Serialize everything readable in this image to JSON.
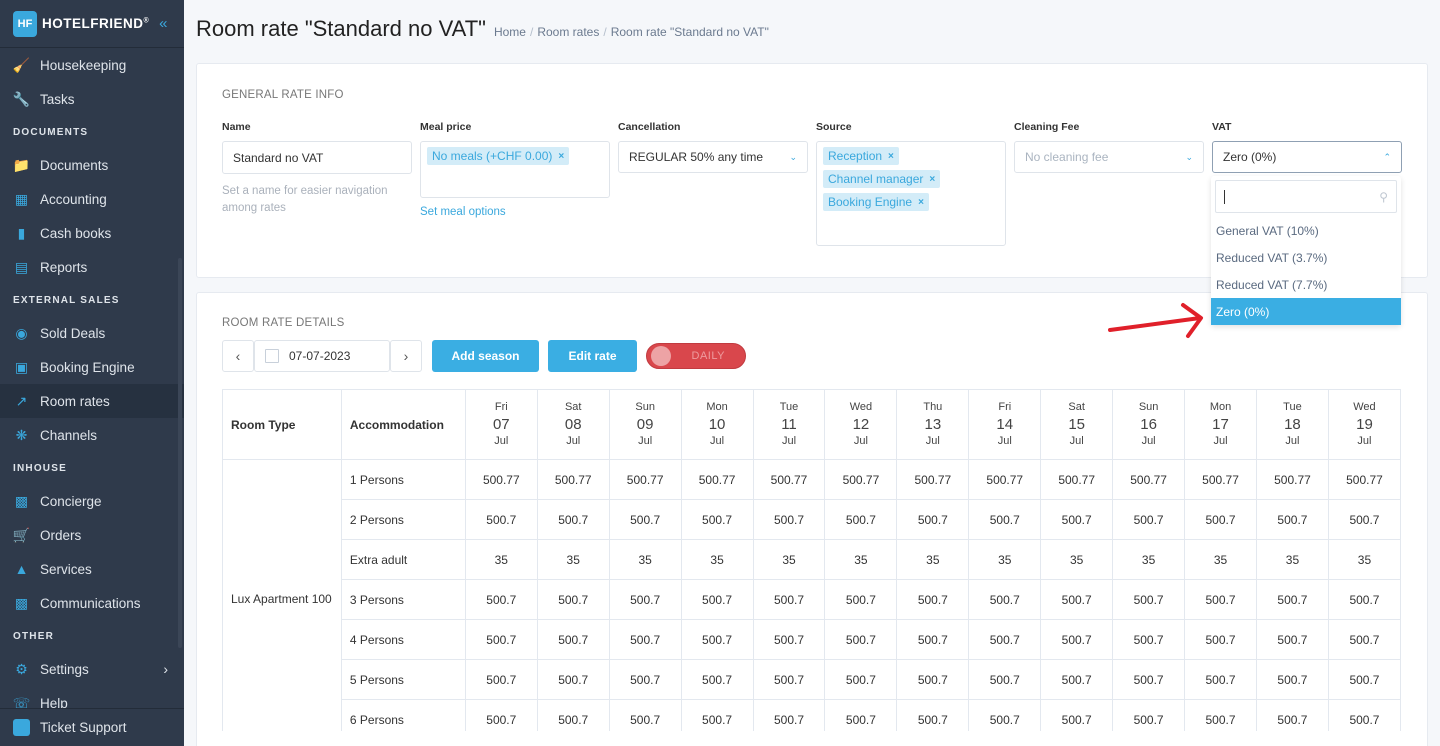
{
  "brand": {
    "name": "HOTELFRIEND",
    "reg": "®",
    "mark": "HF"
  },
  "sidebar": {
    "items": [
      {
        "type": "item",
        "label": "Housekeeping",
        "icon": "broom-icon"
      },
      {
        "type": "item",
        "label": "Tasks",
        "icon": "wrench-icon"
      },
      {
        "type": "section",
        "label": "DOCUMENTS"
      },
      {
        "type": "item",
        "label": "Documents",
        "icon": "folder-icon"
      },
      {
        "type": "item",
        "label": "Accounting",
        "icon": "calculator-icon"
      },
      {
        "type": "item",
        "label": "Cash books",
        "icon": "cash-book-icon"
      },
      {
        "type": "item",
        "label": "Reports",
        "icon": "clipboard-icon"
      },
      {
        "type": "section",
        "label": "EXTERNAL SALES"
      },
      {
        "type": "item",
        "label": "Sold Deals",
        "icon": "tag-icon"
      },
      {
        "type": "item",
        "label": "Booking Engine",
        "icon": "booking-engine-icon"
      },
      {
        "type": "item",
        "label": "Room rates",
        "icon": "chart-up-icon",
        "active": true
      },
      {
        "type": "item",
        "label": "Channels",
        "icon": "network-icon"
      },
      {
        "type": "section",
        "label": "INHOUSE"
      },
      {
        "type": "item",
        "label": "Concierge",
        "icon": "concierge-icon"
      },
      {
        "type": "item",
        "label": "Orders",
        "icon": "cart-icon"
      },
      {
        "type": "item",
        "label": "Services",
        "icon": "bell-icon"
      },
      {
        "type": "item",
        "label": "Communications",
        "icon": "chat-icon"
      },
      {
        "type": "section",
        "label": "OTHER"
      },
      {
        "type": "item",
        "label": "Settings",
        "icon": "gear-icon",
        "chevron": true
      },
      {
        "type": "item",
        "label": "Help",
        "icon": "headset-icon"
      }
    ],
    "footer": {
      "label": "Ticket Support",
      "icon": "ticket-support-icon"
    }
  },
  "header": {
    "title": "Room rate \"Standard no VAT\"",
    "breadcrumb": [
      "Home",
      "Room rates",
      "Room rate \"Standard no VAT\""
    ]
  },
  "general": {
    "section_title": "GENERAL RATE INFO",
    "name": {
      "label": "Name",
      "value": "Standard no VAT",
      "help": "Set a name for easier navigation among rates"
    },
    "meal": {
      "label": "Meal price",
      "tags": [
        "No meals (+CHF 0.00)"
      ],
      "link": "Set meal options"
    },
    "cancellation": {
      "label": "Cancellation",
      "value": "REGULAR 50% any time"
    },
    "source": {
      "label": "Source",
      "tags": [
        "Reception",
        "Channel manager",
        "Booking Engine"
      ]
    },
    "cleaning": {
      "label": "Cleaning Fee",
      "placeholder": "No cleaning fee"
    },
    "vat": {
      "label": "VAT",
      "value": "Zero (0%)",
      "options": [
        "General VAT (10%)",
        "Reduced VAT (3.7%)",
        "Reduced VAT (7.7%)",
        "Zero (0%)"
      ],
      "selected_index": 3
    }
  },
  "details": {
    "section_title": "ROOM RATE DETAILS",
    "date": "07-07-2023",
    "add_season": "Add season",
    "edit_rate": "Edit rate",
    "toggle_label": "DAILY",
    "table": {
      "col_room_type": "Room Type",
      "col_accommodation": "Accommodation",
      "days": [
        {
          "dow": "Fri",
          "day": "07",
          "month": "Jul"
        },
        {
          "dow": "Sat",
          "day": "08",
          "month": "Jul"
        },
        {
          "dow": "Sun",
          "day": "09",
          "month": "Jul"
        },
        {
          "dow": "Mon",
          "day": "10",
          "month": "Jul"
        },
        {
          "dow": "Tue",
          "day": "11",
          "month": "Jul"
        },
        {
          "dow": "Wed",
          "day": "12",
          "month": "Jul"
        },
        {
          "dow": "Thu",
          "day": "13",
          "month": "Jul"
        },
        {
          "dow": "Fri",
          "day": "14",
          "month": "Jul"
        },
        {
          "dow": "Sat",
          "day": "15",
          "month": "Jul"
        },
        {
          "dow": "Sun",
          "day": "16",
          "month": "Jul"
        },
        {
          "dow": "Mon",
          "day": "17",
          "month": "Jul"
        },
        {
          "dow": "Tue",
          "day": "18",
          "month": "Jul"
        },
        {
          "dow": "Wed",
          "day": "19",
          "month": "Jul"
        }
      ],
      "room_type": "Lux Apartment 100",
      "rows": [
        {
          "accommodation": "1 Persons",
          "value": "500.77"
        },
        {
          "accommodation": "2 Persons",
          "value": "500.7"
        },
        {
          "accommodation": "Extra adult",
          "value": "35"
        },
        {
          "accommodation": "3 Persons",
          "value": "500.7"
        },
        {
          "accommodation": "4 Persons",
          "value": "500.7"
        },
        {
          "accommodation": "5 Persons",
          "value": "500.7"
        },
        {
          "accommodation": "6 Persons",
          "value": "500.7"
        }
      ]
    }
  },
  "colors": {
    "accent": "#3aaee3",
    "sidebar": "#2f3a4b",
    "toggle_off": "#d9474c",
    "annotation_arrow": "#e0202a"
  }
}
